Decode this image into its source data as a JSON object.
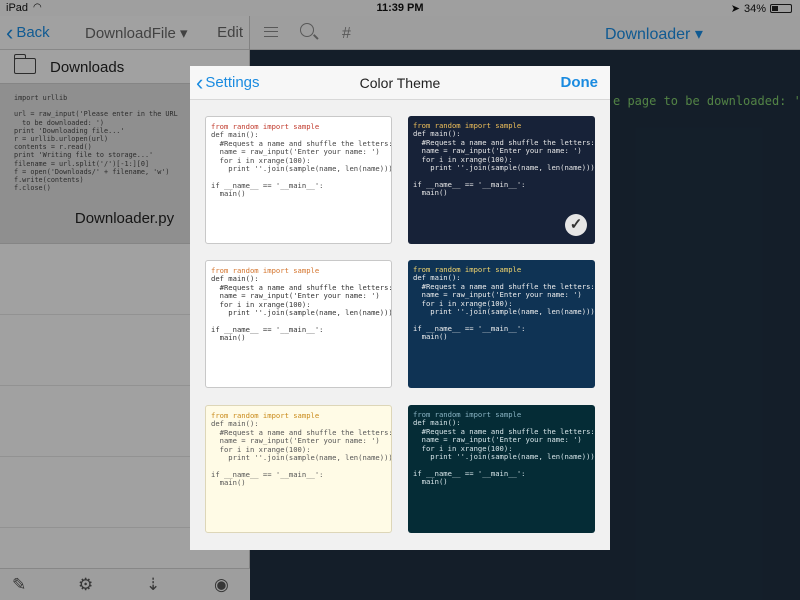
{
  "status_bar": {
    "carrier": "iPad",
    "time": "11:39 PM",
    "battery": "34%"
  },
  "left_pane": {
    "back_label": "Back",
    "title": "DownloadFile ▾",
    "edit_label": "Edit",
    "folder_label": "Downloads",
    "file_name": "Downloader.py",
    "code_preview": "import urllib\n\nurl = raw_input('Please enter in the URL\n  to be downloaded: ')\nprint 'Downloading file...'\nr = urllib.urlopen(url)\ncontents = r.read()\nprint 'Writing file to storage...'\nfilename = url.split('/')[-1:][0]\nf = open('Downloads/' + filename, 'w')\nf.write(contents)\nf.close()"
  },
  "right_pane": {
    "title": "Downloader ▾",
    "code_fragment": "e page to be downloaded: ')"
  },
  "modal": {
    "back_label": "Settings",
    "title": "Color Theme",
    "done_label": "Done",
    "code_sample": "def main():\n  #Request a name and shuffle the letters:\n  name = raw_input('Enter your name: ')\n  for i in xrange(100):\n    print ''.join(sample(name, len(name)))\n\nif __name__ == '__main__':\n  main()",
    "import_line": "from random import sample",
    "themes": [
      {
        "name": "light",
        "selected": false
      },
      {
        "name": "dark-navy",
        "selected": true
      },
      {
        "name": "light-alt",
        "selected": false
      },
      {
        "name": "dark-blue",
        "selected": false
      },
      {
        "name": "cream",
        "selected": false
      },
      {
        "name": "dark-teal",
        "selected": false
      }
    ]
  },
  "icons": {
    "compose": "compose-icon",
    "settings": "gear-icon",
    "sort": "sort-icon",
    "preview": "eye-icon",
    "checkmark": "checkmark-icon"
  },
  "colors": {
    "accent": "#1a8be0",
    "editor_bg": "#1f2f40"
  }
}
